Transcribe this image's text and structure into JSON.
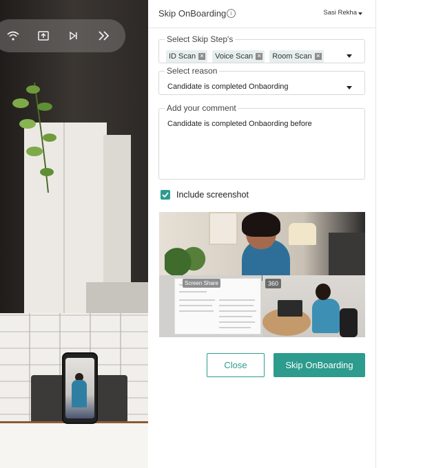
{
  "colors": {
    "accent": "#2d9b8d",
    "chip_bg": "#e6efee"
  },
  "toolbar": {
    "icons": [
      "wifi-icon",
      "screen-share-icon",
      "skip-next-icon",
      "fast-forward-icon"
    ]
  },
  "header": {
    "title": "Skip OnBoarding",
    "user": "Sasi Rekha"
  },
  "skip_steps": {
    "legend": "Select Skip Step's",
    "chips": [
      {
        "label": "ID Scan"
      },
      {
        "label": "Voice Scan"
      },
      {
        "label": "Room Scan"
      }
    ]
  },
  "reason": {
    "legend": "Select reason",
    "value": "Candidate is completed Onbaording"
  },
  "comment": {
    "legend": "Add your comment",
    "value": "Candidate is completed Onbaording before"
  },
  "include_screenshot": {
    "label": "Include screenshot",
    "checked": true
  },
  "screenshot": {
    "screen_share_tag": "Screen Share",
    "cam_tag": "360"
  },
  "actions": {
    "close": "Close",
    "skip": "Skip OnBoarding"
  }
}
